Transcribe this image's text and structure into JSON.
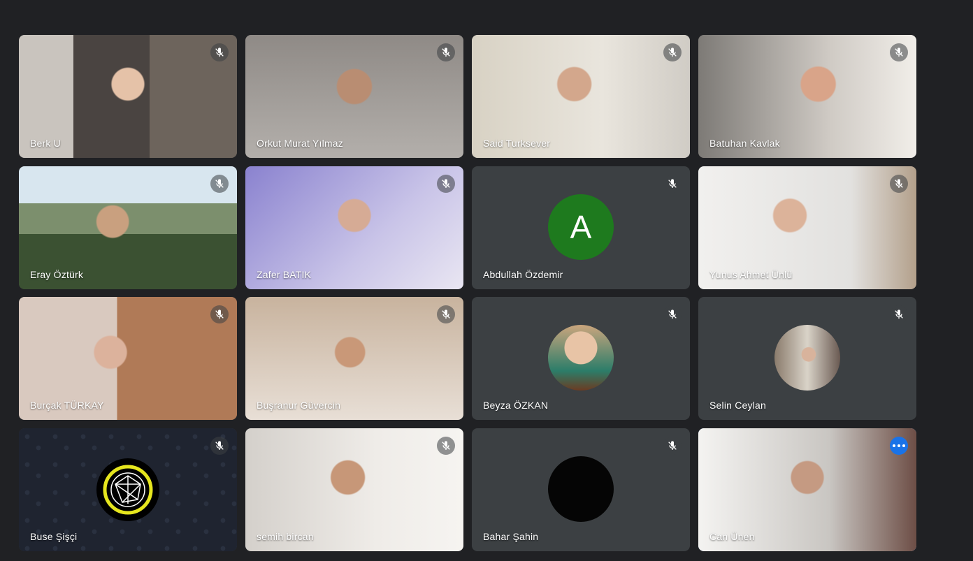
{
  "participants": [
    {
      "name": "Berk U",
      "mic": "muted"
    },
    {
      "name": "Orkut Murat Yılmaz",
      "mic": "muted"
    },
    {
      "name": "Said Turksever",
      "mic": "muted"
    },
    {
      "name": "Batuhan Kavlak",
      "mic": "muted"
    },
    {
      "name": "Eray Öztürk",
      "mic": "muted"
    },
    {
      "name": "Zafer BATIK",
      "mic": "muted"
    },
    {
      "name": "Abdullah Özdemir",
      "mic": "muted",
      "avatar_letter": "A"
    },
    {
      "name": "Yunus Ahmet Ünlü",
      "mic": "muted"
    },
    {
      "name": "Burçak TÜRKAY",
      "mic": "muted"
    },
    {
      "name": "Buşranur Güvercin",
      "mic": "muted"
    },
    {
      "name": "Beyza ÖZKAN",
      "mic": "muted"
    },
    {
      "name": "Selin Ceylan",
      "mic": "muted"
    },
    {
      "name": "Buse Şişçi",
      "mic": "muted"
    },
    {
      "name": "semih bircan",
      "mic": "muted"
    },
    {
      "name": "Bahar Şahin",
      "mic": "muted"
    },
    {
      "name": "Can Ünen",
      "mic": "unmuted",
      "active": true
    }
  ],
  "colors": {
    "background": "#202124",
    "tile": "#3c4043",
    "active_border": "#8ab4f8",
    "more_button": "#1a73e8"
  }
}
